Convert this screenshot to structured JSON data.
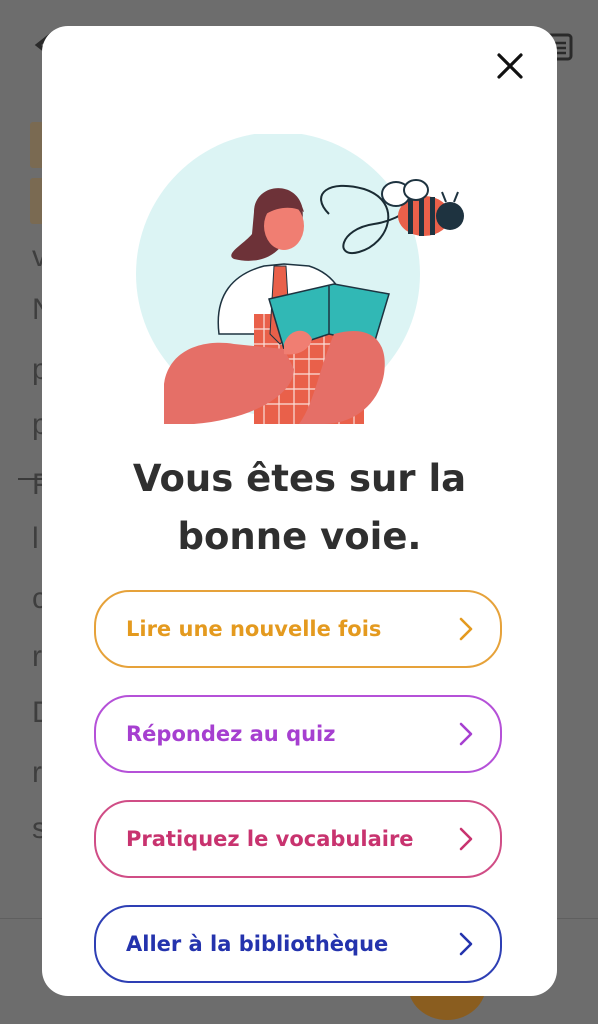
{
  "background": {
    "letters": [
      "v",
      "N",
      "p",
      "p",
      "P",
      "l",
      "c",
      "r",
      "D",
      "r",
      "s"
    ]
  },
  "modal": {
    "close_icon": "close-icon",
    "illustration": "woman-reading-book-with-bee",
    "headline_line1": "Vous êtes sur la",
    "headline_line2": "bonne voie.",
    "actions": [
      {
        "label": "Lire une nouvelle fois",
        "color": "#e6a23a",
        "text_color": "#e49a1f"
      },
      {
        "label": "Répondez au quiz",
        "color": "#b551d8",
        "text_color": "#a63fd0"
      },
      {
        "label": "Pratiquez le vocabulaire",
        "color": "#d04d86",
        "text_color": "#c8336f"
      },
      {
        "label": "Aller à la bibliothèque",
        "color": "#2e3fb4",
        "text_color": "#2433ad"
      }
    ]
  }
}
